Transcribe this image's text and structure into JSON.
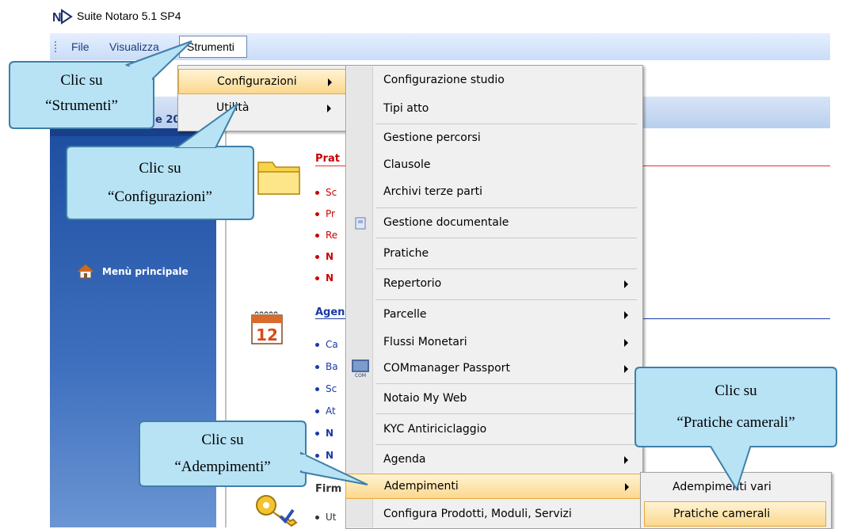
{
  "window": {
    "title": "Suite Notaro 5.1 SP4",
    "logo_text": "NS"
  },
  "menubar": {
    "items": [
      {
        "label": "File"
      },
      {
        "label": "Visualizza"
      },
      {
        "label": "Strumenti"
      }
    ]
  },
  "header": {
    "partial_text": "e 20"
  },
  "sidebar": {
    "items": [
      {
        "label": "Menù principale",
        "icon": "house-icon"
      }
    ]
  },
  "content": {
    "sections": [
      {
        "title": "Prat",
        "color": "#cc0000",
        "icon": "folder-icon",
        "bullets": [
          {
            "text": "Sc"
          },
          {
            "text": "Pr"
          },
          {
            "text": "Re"
          },
          {
            "text": "N",
            "bold": true
          },
          {
            "text": "N",
            "bold": true
          }
        ]
      },
      {
        "title": "Agen",
        "color": "#1a3aa8",
        "icon": "calendar-icon",
        "bullets": [
          {
            "text": "Ca"
          },
          {
            "text": "Ba"
          },
          {
            "text": "Sc"
          },
          {
            "text": "At"
          },
          {
            "text": "N",
            "bold": true
          },
          {
            "text": "N",
            "bold": true
          }
        ]
      },
      {
        "title": "Firm",
        "color": "#333333",
        "icon": "key-icon",
        "bullets": [
          {
            "text": "Ut"
          }
        ]
      }
    ]
  },
  "menus": {
    "strumenti": [
      {
        "label": "Configurazioni",
        "submenu": true,
        "highlighted": true
      },
      {
        "label": "Utilità",
        "submenu": true
      }
    ],
    "configurazioni": [
      {
        "label": "Configurazione studio"
      },
      {
        "label": "Tipi atto"
      },
      {
        "label": "Gestione percorsi"
      },
      {
        "label": "Clausole"
      },
      {
        "label": "Archivi terze parti"
      },
      {
        "label": "Gestione documentale",
        "icon": "document-manager-icon"
      },
      {
        "label": "Pratiche"
      },
      {
        "label": "Repertorio",
        "submenu": true
      },
      {
        "label": "Parcelle",
        "submenu": true
      },
      {
        "label": "Flussi Monetari",
        "submenu": true
      },
      {
        "label": "COMmanager Passport",
        "submenu": true,
        "icon": "commanager-icon"
      },
      {
        "label": "Notaio My Web"
      },
      {
        "label": "KYC Antiriciclaggio"
      },
      {
        "label": "Agenda",
        "submenu": true
      },
      {
        "label": "Adempimenti",
        "submenu": true,
        "highlighted": true
      },
      {
        "label": "Configura Prodotti, Moduli, Servizi"
      }
    ],
    "adempimenti": [
      {
        "label": "Adempimenti vari"
      },
      {
        "label": "Pratiche camerali",
        "highlighted": true
      }
    ]
  },
  "callouts": [
    {
      "line1": "Clic su",
      "line2": "“Strumenti”"
    },
    {
      "line1": "Clic su",
      "line2": "“Configurazioni”"
    },
    {
      "line1": "Clic su",
      "line2": "“Adempimenti”"
    },
    {
      "line1": "Clic su",
      "line2": "“Pratiche camerali”"
    }
  ],
  "colors": {
    "accent": "#fbd88d",
    "menubar": "#c9dcf7",
    "sidebar": "#2b5cab",
    "callout_fill": "#b7e3f5",
    "callout_border": "#3f7fa8"
  }
}
